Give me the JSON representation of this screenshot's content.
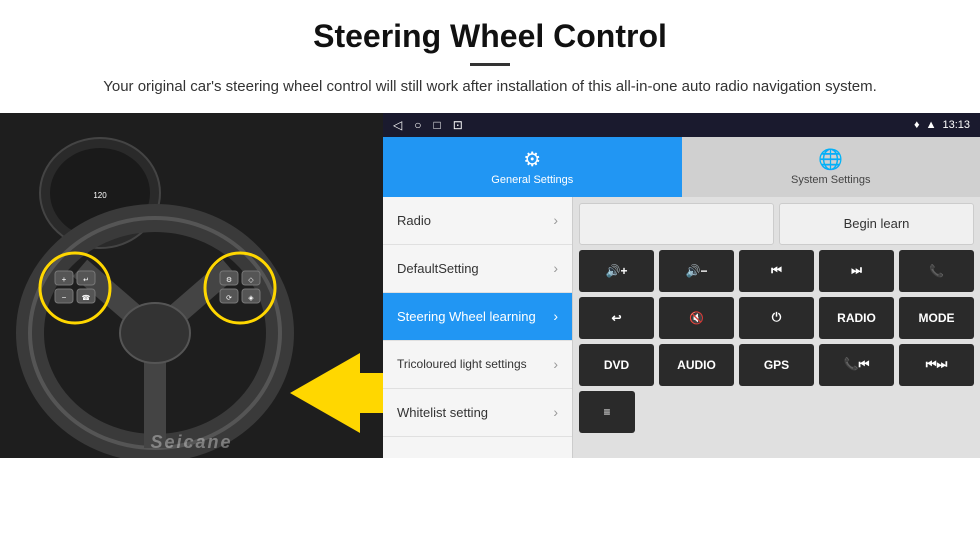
{
  "header": {
    "title": "Steering Wheel Control",
    "subtitle": "Your original car's steering wheel control will still work after installation of this all-in-one auto radio navigation system."
  },
  "status_bar": {
    "icons": [
      "◁",
      "○",
      "□",
      "⊡"
    ],
    "right_icons": "♦ ▲",
    "time": "13:13"
  },
  "tabs": [
    {
      "id": "general",
      "label": "General Settings",
      "active": true
    },
    {
      "id": "system",
      "label": "System Settings",
      "active": false
    }
  ],
  "menu_items": [
    {
      "id": "radio",
      "label": "Radio",
      "active": false
    },
    {
      "id": "default",
      "label": "DefaultSetting",
      "active": false
    },
    {
      "id": "steering",
      "label": "Steering Wheel learning",
      "active": true
    },
    {
      "id": "tricoloured",
      "label": "Tricoloured light settings",
      "active": false
    },
    {
      "id": "whitelist",
      "label": "Whitelist setting",
      "active": false
    }
  ],
  "controls": {
    "row1": {
      "empty": "",
      "begin_learn": "Begin learn"
    },
    "row2": {
      "buttons": [
        "🔊+",
        "🔊−",
        "⏮",
        "⏭",
        "📞"
      ]
    },
    "row3": {
      "buttons": [
        "↩",
        "🔊×",
        "⏻",
        "RADIO",
        "MODE"
      ]
    },
    "row4": {
      "buttons": [
        "DVD",
        "AUDIO",
        "GPS",
        "📞⏮",
        "⏮⏭"
      ]
    },
    "row5": {
      "buttons": [
        "≡"
      ]
    }
  },
  "watermark": "Seicane"
}
